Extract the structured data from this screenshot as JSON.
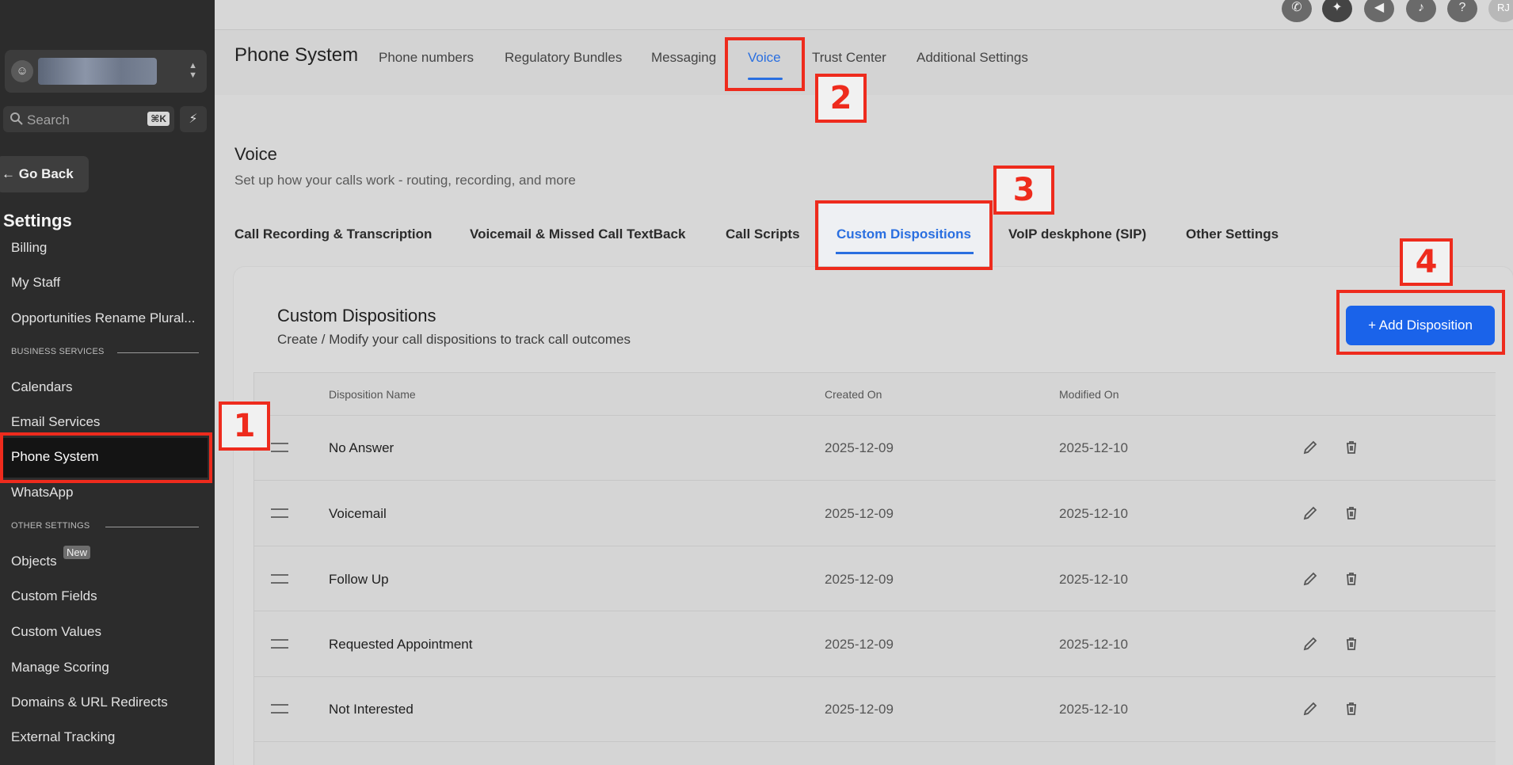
{
  "sidebar": {
    "search_placeholder": "Search",
    "search_shortcut": "⌘K",
    "go_back": "Go Back",
    "settings_title": "Settings",
    "items_top": [
      "Billing",
      "My Staff",
      "Opportunities Rename Plural..."
    ],
    "group_business": "BUSINESS SERVICES",
    "items_business": [
      "Calendars",
      "Email Services",
      "Phone System",
      "WhatsApp"
    ],
    "group_other": "OTHER SETTINGS",
    "items_other": [
      "Objects",
      "Custom Fields",
      "Custom Values",
      "Manage Scoring",
      "Domains & URL Redirects",
      "External Tracking"
    ],
    "new_badge": "New",
    "active_item": "Phone System"
  },
  "topbar": {
    "icons": [
      "phone-icon",
      "satellite-icon",
      "megaphone-icon",
      "bell-icon",
      "help-icon"
    ],
    "user_initials": "RJ"
  },
  "header": {
    "page_title": "Phone System",
    "tabs": [
      "Phone numbers",
      "Regulatory Bundles",
      "Messaging",
      "Voice",
      "Trust Center",
      "Additional Settings"
    ],
    "active_tab": "Voice"
  },
  "voice": {
    "title": "Voice",
    "subtitle": "Set up how your calls work - routing, recording, and more",
    "tabs": [
      "Call Recording & Transcription",
      "Voicemail & Missed Call TextBack",
      "Call Scripts",
      "Custom Dispositions",
      "VoIP deskphone (SIP)",
      "Other Settings"
    ],
    "active_tab": "Custom Dispositions"
  },
  "dispositions": {
    "title": "Custom Dispositions",
    "subtitle": "Create / Modify your call dispositions to track call outcomes",
    "add_button": "+ Add Disposition",
    "columns": [
      "Disposition Name",
      "Created On",
      "Modified On"
    ],
    "rows": [
      {
        "name": "No Answer",
        "created": "2025-12-09",
        "modified": "2025-12-10"
      },
      {
        "name": "Voicemail",
        "created": "2025-12-09",
        "modified": "2025-12-10"
      },
      {
        "name": "Follow Up",
        "created": "2025-12-09",
        "modified": "2025-12-10"
      },
      {
        "name": "Requested Appointment",
        "created": "2025-12-09",
        "modified": "2025-12-10"
      },
      {
        "name": "Not Interested",
        "created": "2025-12-09",
        "modified": "2025-12-10"
      }
    ]
  },
  "annotations": [
    "1",
    "2",
    "3",
    "4"
  ],
  "colors": {
    "accent": "#1a63ea",
    "highlight": "#ee2b1d",
    "sidebar": "#2c2c2c"
  }
}
